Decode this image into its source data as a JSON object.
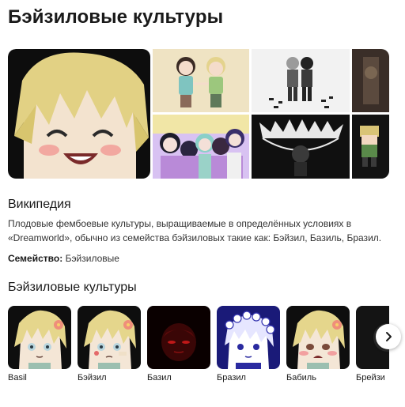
{
  "page": {
    "title": "Бэйзиловые культуры"
  },
  "gallery": {
    "images": [
      {
        "icon": "basil-smiling-closeup-image"
      },
      {
        "icon": "characters-waving-image"
      },
      {
        "icon": "two-boys-standing-image"
      },
      {
        "icon": "dark-partial-image"
      },
      {
        "icon": "group-photo-image"
      },
      {
        "icon": "dark-monster-image"
      },
      {
        "icon": "pixel-sprite-image"
      }
    ]
  },
  "wiki": {
    "heading": "Википедия",
    "text": "Плодовые фембоевые культуры, выращиваемые в определённых условиях в «Dreamworld», обычно из семейства бэйзиловых такие как: Бэйзил, Базиль, Бразил.",
    "family_label": "Семейство:",
    "family_value": "Бэйзиловые"
  },
  "related": {
    "heading": "Бэйзиловые культуры",
    "items": [
      {
        "label": "Basil",
        "icon": "basil-portrait"
      },
      {
        "label": "Бэйзил",
        "icon": "basil-bandaged-portrait"
      },
      {
        "label": "Базил",
        "icon": "dark-red-portrait"
      },
      {
        "label": "Бразил",
        "icon": "blue-flower-crown-portrait"
      },
      {
        "label": "Бабиль",
        "icon": "crying-basil-portrait"
      },
      {
        "label": "Брейзи",
        "icon": "dark-portrait"
      }
    ],
    "next_icon": "chevron-right-icon"
  },
  "colors": {
    "accent_text": "#1a1a1a",
    "basil_hair": "#e6d99a"
  }
}
